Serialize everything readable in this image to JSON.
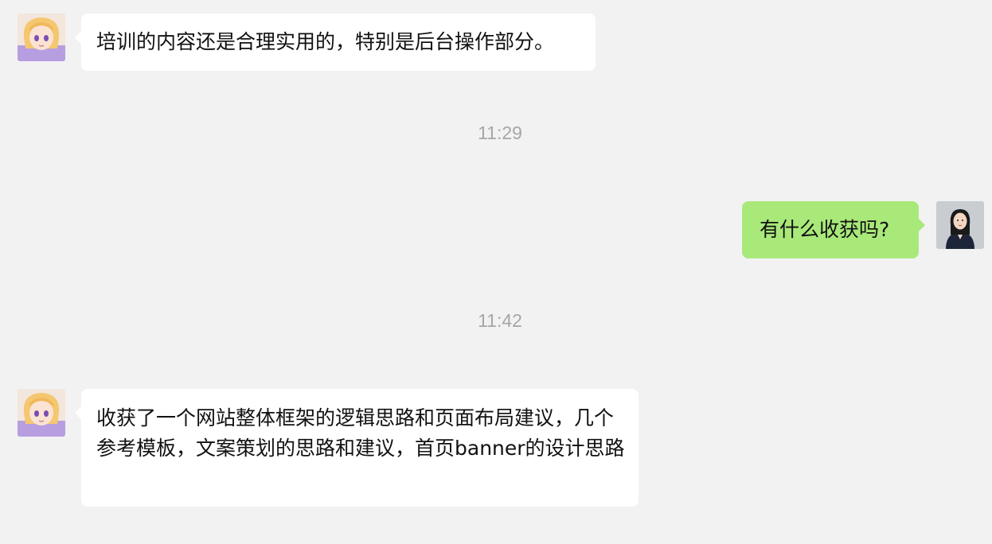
{
  "messages": [
    {
      "sender": "other",
      "avatar": "anime-girl-avatar",
      "text": "培训的内容还是合理实用的，特别是后台操作部分。"
    },
    {
      "type": "timestamp",
      "text": "11:29"
    },
    {
      "sender": "self",
      "avatar": "woman-photo-avatar",
      "text": "有什么收获吗?"
    },
    {
      "type": "timestamp",
      "text": "11:42"
    },
    {
      "sender": "other",
      "avatar": "anime-girl-avatar",
      "text": "收获了一个网站整体框架的逻辑思路和页面布局建议，几个参考模板，文案策划的思路和建议，首页banner的设计思路"
    }
  ],
  "colors": {
    "background": "#f2f2f2",
    "incoming_bubble": "#ffffff",
    "outgoing_bubble": "#a9e97a",
    "timestamp": "#a6a6a6"
  }
}
